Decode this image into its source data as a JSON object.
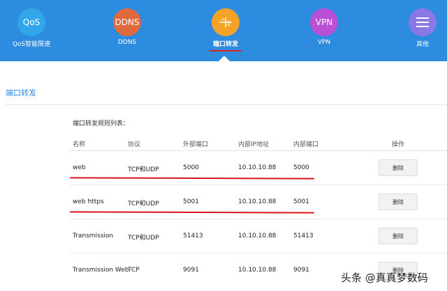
{
  "nav": {
    "items": [
      {
        "key": "qos",
        "icon_text": "QoS",
        "label": "QoS智能限速",
        "color": "#31a6e8",
        "active": false
      },
      {
        "key": "ddns",
        "icon_text": "DDNS",
        "label": "DDNS",
        "color": "#e06a3e",
        "active": false
      },
      {
        "key": "port",
        "icon_text": "",
        "label": "端口转发",
        "color": "#f5a327",
        "active": true
      },
      {
        "key": "vpn",
        "icon_text": "VPN",
        "label": "VPN",
        "color": "#bb4fd6",
        "active": false
      },
      {
        "key": "other",
        "icon_text": "",
        "label": "其他",
        "color": "#8b78e6",
        "active": false
      }
    ],
    "bg_color": "#2d8ce0"
  },
  "section": {
    "title": "端口转发",
    "list_caption": "端口转发规则列表："
  },
  "table": {
    "headers": {
      "name": "名称",
      "protocol": "协议",
      "external_port": "外部端口",
      "internal_ip": "内部IP地址",
      "internal_port": "内部端口",
      "action": "操作"
    },
    "rows": [
      {
        "name": "web",
        "protocol": "TCP和UDP",
        "external_port": "5000",
        "internal_ip": "10.10.10.88",
        "internal_port": "5000",
        "delete_label": "删除",
        "underlined": true
      },
      {
        "name": "web https",
        "protocol": "TCP和UDP",
        "external_port": "5001",
        "internal_ip": "10.10.10.88",
        "internal_port": "5001",
        "delete_label": "删除",
        "underlined": true
      },
      {
        "name": "Transmission",
        "protocol": "TCP和UDP",
        "external_port": "51413",
        "internal_ip": "10.10.10.88",
        "internal_port": "51413",
        "delete_label": "删除",
        "underlined": false
      },
      {
        "name": "Transmission Web",
        "protocol": "TCP",
        "external_port": "9091",
        "internal_ip": "10.10.10.88",
        "internal_port": "9091",
        "delete_label": "删除",
        "underlined": false
      }
    ]
  },
  "watermark": {
    "text": "头条 @真真梦数码"
  },
  "colors": {
    "accent": "#2d8ce0",
    "annotation_red": "#d8151c"
  }
}
